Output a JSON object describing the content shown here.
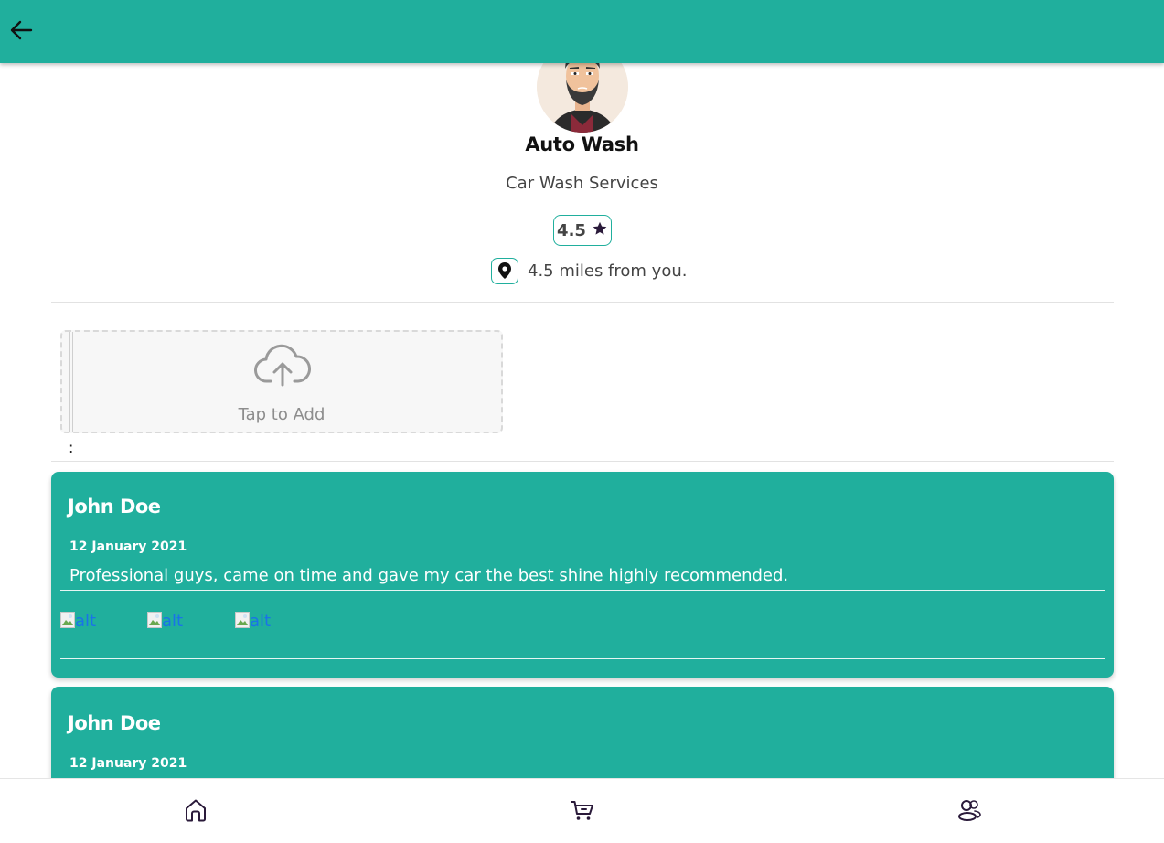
{
  "header": {
    "back_icon": "arrow-left-icon"
  },
  "business": {
    "name": "Auto Wash",
    "category": "Car Wash Services",
    "rating": "4.5",
    "rating_icon": "star-icon",
    "location_icon": "map-pin-icon",
    "distance_text": "4.5 miles from you."
  },
  "upload": {
    "icon": "cloud-upload-icon",
    "label": "Tap to Add",
    "colon": ":"
  },
  "reviews": [
    {
      "name": "John Doe",
      "date": "12 January 2021",
      "text": "Professional guys, came on time and gave my car the best shine highly recommended.",
      "images": [
        "alt",
        "alt",
        "alt"
      ]
    },
    {
      "name": "John Doe",
      "date": "12 January 2021"
    }
  ],
  "bottom_nav": [
    "home-icon",
    "cart-icon",
    "users-icon"
  ],
  "colors": {
    "primary": "#20af9d",
    "star": "#2a1a3a"
  }
}
